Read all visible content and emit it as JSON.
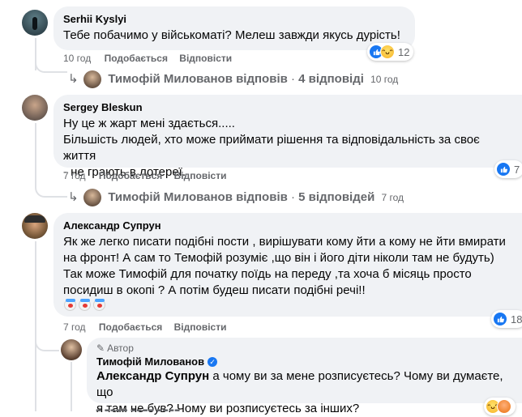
{
  "c1": {
    "author": "Serhii Kyslyi",
    "text": "Тебе побачимо у військоматі? Мелеш завжди якусь дурість!",
    "time": "10 год",
    "like": "Подобається",
    "reply": "Відповісти",
    "reactions": "12",
    "replies_summary": {
      "author_action": "Тимофій Милованов відповів",
      "count": "4 відповіді",
      "time": "10 год"
    }
  },
  "c2": {
    "author": "Sergey Bleskun",
    "lines": [
      "Ну це ж жарт мені здається.....",
      "Більшість людей, хто може приймати рішення та відповідальність за своє життя",
      "- не грають в лотереї."
    ],
    "time": "7 год",
    "like": "Подобається",
    "reply": "Відповісти",
    "reactions": "7",
    "replies_summary": {
      "author_action": "Тимофій Милованов відповів",
      "count": "5 відповідей",
      "time": "7 год"
    }
  },
  "c3": {
    "author": "Александр Супрун",
    "lines": [
      "Як же легко писати подібні пости , вирішувати кому йти а кому не йти вмирати",
      "на фронт! А сам то Темофій розуміє ,що він і його діти ніколи там не будуть)",
      "Так може Тимофій для початку поїдь на переду ,та хоча б місяць просто",
      "посидиш в окопі ? А потім будеш писати подібні речі!!"
    ],
    "time": "7 год",
    "like": "Подобається",
    "reply": "Відповісти",
    "reactions": "18"
  },
  "r1": {
    "badge": "Автор",
    "author": "Тимофій Милованов",
    "mention": "Александр Супрун",
    "line1": " а чому ви за мене розписуєтесь? Чому ви думаєте, що",
    "line2": "я там не був? Чому ви розписуєтесь за інших?"
  },
  "colors": {
    "bubble": "#f0f2f5",
    "meta": "#65676b",
    "like_blue": "#1877f2",
    "verified": "#1877f2"
  }
}
